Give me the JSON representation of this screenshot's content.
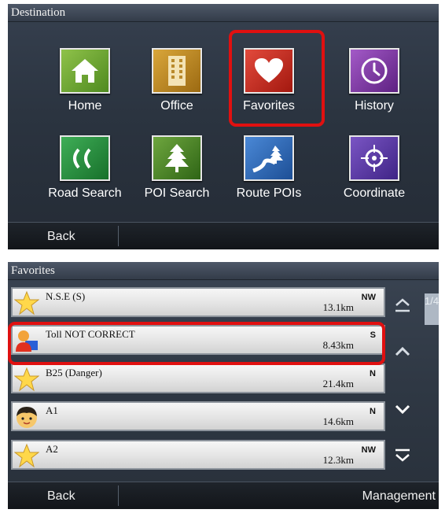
{
  "destination": {
    "title": "Destination",
    "tiles": [
      {
        "label": "Home",
        "icon": "home-icon"
      },
      {
        "label": "Office",
        "icon": "office-building-icon"
      },
      {
        "label": "Favorites",
        "icon": "heart-icon"
      },
      {
        "label": "History",
        "icon": "clock-icon"
      },
      {
        "label": "Road Search",
        "icon": "road-icon"
      },
      {
        "label": "POI Search",
        "icon": "tree-icon"
      },
      {
        "label": "Route POIs",
        "icon": "route-road-icon"
      },
      {
        "label": "Coordinate",
        "icon": "crosshair-icon"
      }
    ],
    "back_label": "Back",
    "highlight_color": "#e01010"
  },
  "favorites": {
    "title": "Favorites",
    "page_indicator": "1/4",
    "items": [
      {
        "name": "N.S.E (S)",
        "distance": "13.1km",
        "direction": "NW",
        "icon": "star-icon"
      },
      {
        "name": "Toll NOT CORRECT",
        "distance": "8.43km",
        "direction": "S",
        "icon": "person-icon"
      },
      {
        "name": "B25 (Danger)",
        "distance": "21.4km",
        "direction": "N",
        "icon": "star-icon"
      },
      {
        "name": "A1",
        "distance": "14.6km",
        "direction": "N",
        "icon": "face-icon"
      },
      {
        "name": "A2",
        "distance": "12.3km",
        "direction": "NW",
        "icon": "star-icon"
      }
    ],
    "back_label": "Back",
    "management_label": "Management"
  }
}
